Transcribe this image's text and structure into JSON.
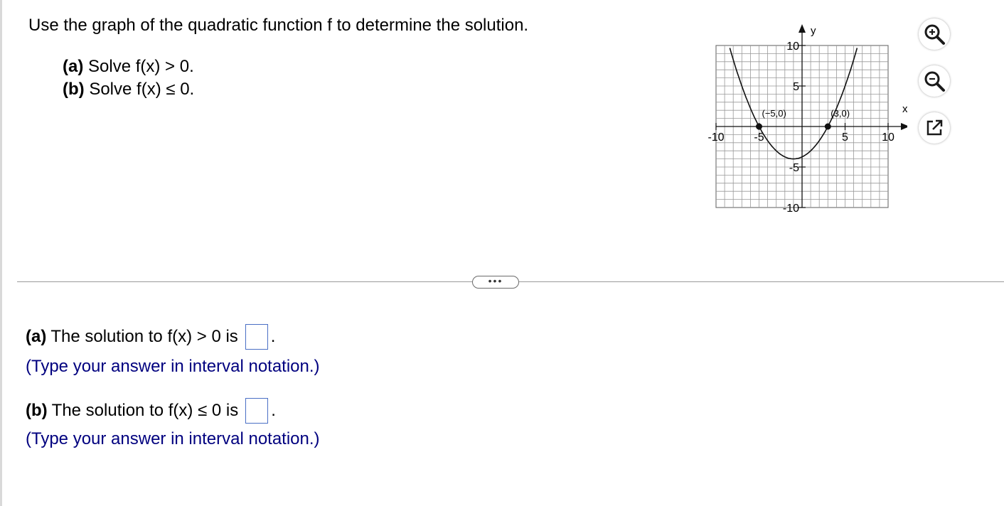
{
  "question": {
    "title": "Use the graph of the quadratic function f to determine the solution.",
    "part_a": {
      "label": "(a)",
      "text": "Solve f(x) > 0."
    },
    "part_b": {
      "label": "(b)",
      "text": "Solve f(x) ≤ 0."
    }
  },
  "graph": {
    "x_axis_label": "x",
    "y_axis_label": "y",
    "x_tick_labels": [
      "-10",
      "-5",
      "5",
      "10"
    ],
    "y_tick_labels": [
      "10",
      "5",
      "-5",
      "-10"
    ],
    "point_labels": [
      "(−5,0)",
      "(3,0)"
    ],
    "xlim": [
      -10,
      10
    ],
    "ylim": [
      -10,
      10
    ],
    "roots": [
      -5,
      3
    ],
    "vertex": [
      -1,
      -4
    ]
  },
  "toolbar": {
    "zoom_in_icon": "zoom-in-icon",
    "zoom_out_icon": "zoom-out-icon",
    "popout_icon": "popout-icon"
  },
  "divider": {
    "more_label": "•••"
  },
  "answers": {
    "a": {
      "label": "(a)",
      "prefix": "The solution to f(x) > 0 is",
      "suffix": ".",
      "hint": "(Type your answer in interval notation.)",
      "value": ""
    },
    "b": {
      "label": "(b)",
      "prefix": "The solution to f(x) ≤ 0 is",
      "suffix": ".",
      "hint": "(Type your answer in interval notation.)",
      "value": ""
    }
  },
  "colors": {
    "accent": "#4a6fc5",
    "hint": "#00007f"
  }
}
